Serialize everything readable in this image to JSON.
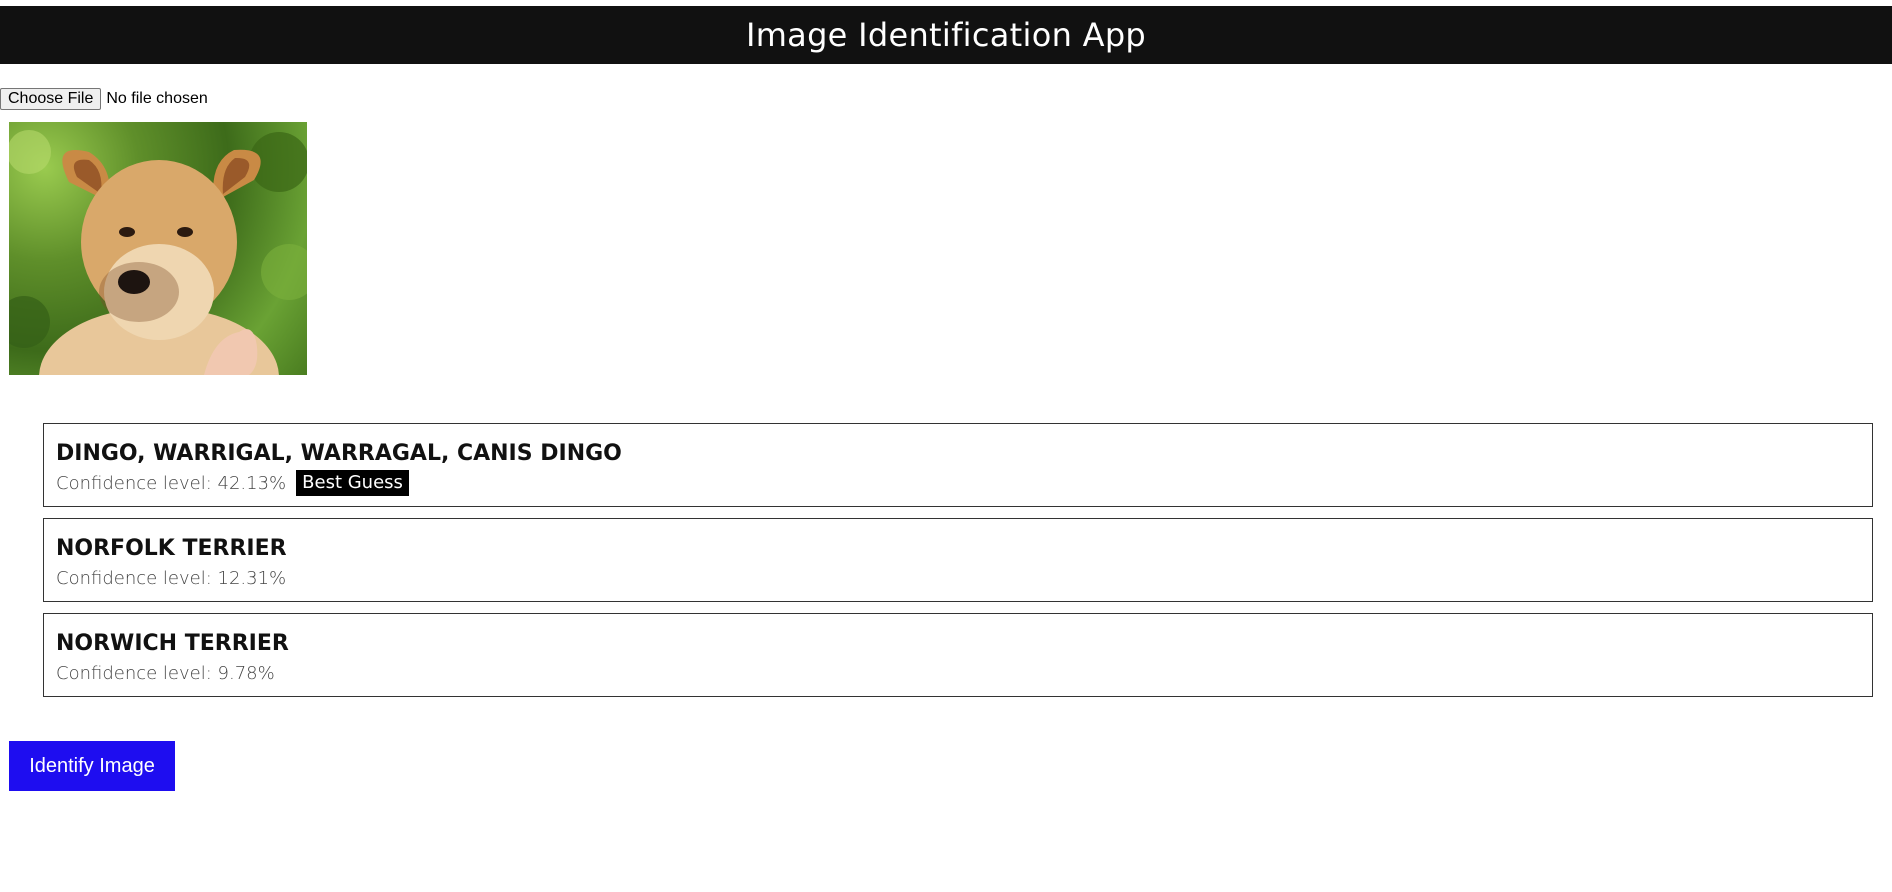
{
  "header": {
    "title": "Image Identification App",
    "background": "#111111"
  },
  "file_input": {
    "button_label": "Choose File",
    "status": "No file chosen"
  },
  "preview": {
    "subject": "puppy photo"
  },
  "results": [
    {
      "name": "DINGO, WARRIGAL, WARRAGAL, CANIS DINGO",
      "confidence": "Confidence level: 42.13%",
      "badge": "Best Guess"
    },
    {
      "name": "NORFOLK TERRIER",
      "confidence": "Confidence level: 12.31%"
    },
    {
      "name": "NORWICH TERRIER",
      "confidence": "Confidence level: 9.78%"
    }
  ],
  "actions": {
    "identify_label": "Identify Image",
    "identify_color": "#1e0df0"
  }
}
